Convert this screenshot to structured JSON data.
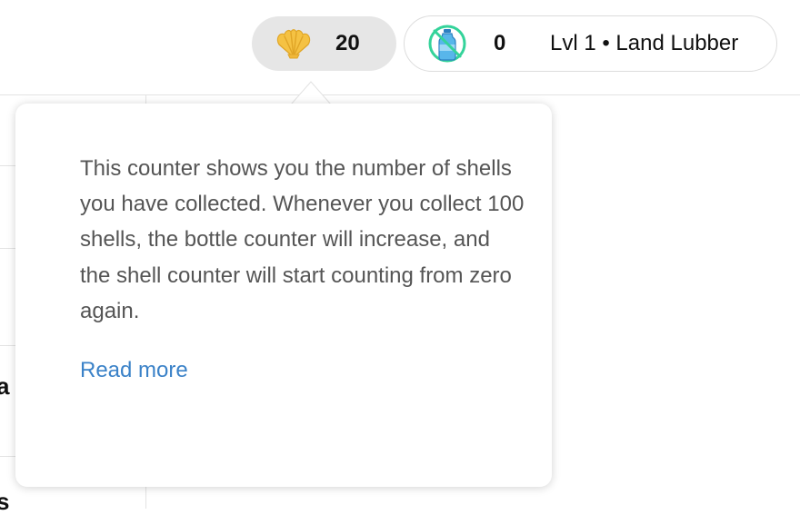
{
  "header": {
    "shells": {
      "icon": "shell-icon",
      "count": "20",
      "icon_color": "#f5c243"
    },
    "status": {
      "icon": "no-plastic-bottle-icon",
      "bottle_count": "0",
      "level_text": "Lvl 1 • Land Lubber",
      "icon_ring_color": "#34d39a",
      "bottle_color": "#3aa0e0"
    }
  },
  "background": {
    "fragments": [
      "a",
      "s"
    ]
  },
  "tooltip": {
    "text": "This counter shows you the number of shells you have collected. Whenever you collect 100 shells, the bottle counter will increase, and the shell counter will start counting from zero again.",
    "read_more_label": "Read more",
    "link_color": "#3b82c8"
  }
}
